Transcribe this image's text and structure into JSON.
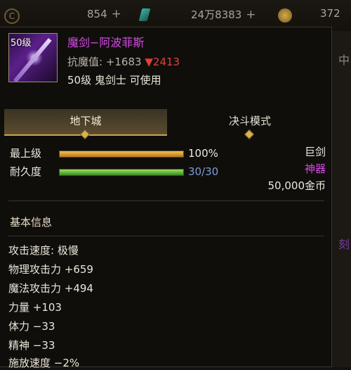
{
  "topbar": {
    "resource1": "854",
    "resource2": "24万8383",
    "resource3": "372",
    "plus": "+"
  },
  "backdrop": {
    "glyph1": "中",
    "glyph2": "刻"
  },
  "item": {
    "level_badge": "50级",
    "name": "魔剑−阿波菲斯",
    "resist_label": "抗魔值: +1683",
    "resist_diff": "▼2413",
    "requirement": "50级 鬼剑士 可使用"
  },
  "tabs": {
    "dungeon": "地下城",
    "duel": "决斗模式"
  },
  "bars": {
    "top_level_label": "最上级",
    "top_level_value": "100%",
    "top_level_fraction": 1.0,
    "durability_label": "耐久度",
    "durability_value": "30/30",
    "durability_fraction": 1.0
  },
  "right_info": {
    "weapon_type": "巨剑",
    "rarity": "神器",
    "price": "50,000金币"
  },
  "basic_info": {
    "title": "基本信息",
    "stats": [
      "攻击速度: 极慢",
      "物理攻击力 +659",
      "魔法攻击力 +494",
      "力量 +103",
      "体力 −33",
      "精神 −33",
      "施放速度 −2%"
    ]
  },
  "colors": {
    "item_name": "#d34be3",
    "rarity": "#d34be3",
    "resist_down": "#e0413a",
    "durability_value": "#7d9ed6"
  }
}
